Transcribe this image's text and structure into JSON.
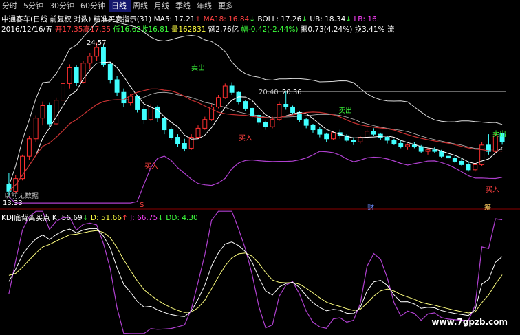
{
  "tabs": [
    {
      "label": "分时",
      "active": false
    },
    {
      "label": "5分钟",
      "active": false
    },
    {
      "label": "30分钟",
      "active": false
    },
    {
      "label": "60分钟",
      "active": false
    },
    {
      "label": "日线",
      "active": true
    },
    {
      "label": "周线",
      "active": false
    },
    {
      "label": "月线",
      "active": false
    },
    {
      "label": "季线",
      "active": false
    },
    {
      "label": "年线",
      "active": false
    },
    {
      "label": "更多",
      "active": false
    }
  ],
  "header": {
    "name": "中通客车(日线 前复权 对数)",
    "indicator": "精准买卖指示(31)",
    "ma5": "MA5: 17.21",
    "ma5_arrow": "↑",
    "ma18": "MA18: 16.84",
    "ma18_arrow": "↓",
    "boll": "BOLL: 17.26",
    "boll_arrow": "↓",
    "ub": "UB: 18.34",
    "ub_arrow": "↓",
    "lb": "LB: 16."
  },
  "quote": {
    "date": "2016/12/16/五",
    "open": "开17.35",
    "high": "高17.35",
    "low": "低16.62",
    "close": "收16.81",
    "vol": "量162831",
    "amount": "额2.76亿",
    "change": "幅-0.42(-2.44%)",
    "amp": "振0.73(4.24%)",
    "turn": "换3.41%",
    "flow": "流"
  },
  "annotations": {
    "high_price": "24.57",
    "mid_price_left": "20.40",
    "mid_price_right": "20.36",
    "sell": "卖出",
    "buy": "买入",
    "low_price": "13.33",
    "no_data": "以前无数据",
    "marker_s": "S",
    "marker_cai": "财",
    "marker_chou": "筹"
  },
  "kdj": {
    "title": "KDJ底背离买点",
    "k": "K: 56.69",
    "k_arrow": "↓",
    "d": "D: 51.66",
    "d_arrow": "↑",
    "j": "J: 66.75",
    "j_arrow": "↓",
    "dd": "DD: 4.30"
  },
  "watermark": "www.7gpzb.com",
  "colors": {
    "up": "#ff3030",
    "down": "#40ffff",
    "ma5": "#ffffff",
    "ma18": "#c83030",
    "boll_mid": "#bbbbbb",
    "purple": "#b040d0",
    "k": "#ffffff",
    "d": "#ffff80",
    "j": "#b040d0"
  },
  "chart_data": {
    "type": "candlestick",
    "price_axis": "log",
    "candles": [
      [
        14.3,
        14.9,
        13.6,
        13.9
      ],
      [
        13.9,
        14.8,
        13.8,
        14.6
      ],
      [
        14.6,
        16.0,
        14.5,
        15.9
      ],
      [
        15.9,
        17.2,
        15.7,
        17.0
      ],
      [
        17.0,
        18.6,
        16.8,
        18.4
      ],
      [
        18.4,
        19.6,
        17.9,
        19.3
      ],
      [
        19.3,
        19.5,
        17.8,
        18.0
      ],
      [
        18.0,
        19.9,
        17.9,
        19.7
      ],
      [
        19.7,
        21.2,
        19.5,
        21.0
      ],
      [
        21.0,
        22.6,
        20.6,
        22.3
      ],
      [
        22.3,
        22.5,
        20.8,
        21.1
      ],
      [
        21.1,
        22.9,
        21.0,
        22.7
      ],
      [
        22.7,
        23.6,
        22.2,
        23.3
      ],
      [
        23.3,
        24.57,
        22.9,
        24.1
      ],
      [
        24.1,
        24.3,
        22.4,
        22.6
      ],
      [
        22.6,
        22.8,
        21.0,
        21.3
      ],
      [
        21.3,
        21.6,
        20.0,
        20.3
      ],
      [
        20.3,
        20.6,
        19.2,
        19.5
      ],
      [
        19.5,
        20.2,
        19.3,
        20.0
      ],
      [
        20.0,
        20.1,
        18.8,
        19.0
      ],
      [
        19.0,
        19.3,
        18.0,
        18.3
      ],
      [
        18.3,
        19.4,
        18.2,
        19.2
      ],
      [
        19.2,
        19.3,
        18.1,
        18.4
      ],
      [
        18.4,
        18.5,
        17.3,
        17.6
      ],
      [
        17.6,
        17.8,
        16.9,
        17.1
      ],
      [
        17.1,
        17.3,
        16.5,
        16.7
      ],
      [
        16.7,
        17.0,
        16.2,
        16.4
      ],
      [
        16.4,
        17.3,
        16.3,
        17.1
      ],
      [
        17.1,
        17.9,
        17.0,
        17.7
      ],
      [
        17.7,
        18.5,
        17.6,
        18.3
      ],
      [
        18.3,
        19.4,
        18.2,
        19.2
      ],
      [
        19.2,
        20.1,
        19.1,
        19.9
      ],
      [
        19.9,
        21.0,
        19.8,
        20.8
      ],
      [
        20.8,
        21.1,
        20.1,
        20.3
      ],
      [
        20.3,
        20.4,
        19.4,
        19.6
      ],
      [
        19.6,
        19.7,
        18.9,
        19.1
      ],
      [
        19.1,
        19.2,
        18.4,
        18.6
      ],
      [
        18.6,
        18.7,
        17.9,
        18.1
      ],
      [
        18.1,
        18.2,
        17.6,
        17.8
      ],
      [
        17.8,
        18.5,
        17.7,
        18.3
      ],
      [
        18.3,
        19.6,
        18.2,
        19.4
      ],
      [
        19.4,
        20.4,
        19.0,
        19.2
      ],
      [
        19.2,
        19.3,
        18.6,
        18.8
      ],
      [
        18.8,
        18.9,
        18.1,
        18.3
      ],
      [
        18.3,
        18.4,
        17.7,
        17.9
      ],
      [
        17.9,
        18.0,
        17.4,
        17.6
      ],
      [
        17.6,
        17.8,
        17.1,
        17.3
      ],
      [
        17.3,
        17.4,
        16.8,
        17.0
      ],
      [
        17.0,
        17.5,
        16.9,
        17.4
      ],
      [
        17.4,
        17.6,
        17.0,
        17.2
      ],
      [
        17.2,
        17.3,
        16.8,
        16.9
      ],
      [
        16.9,
        17.1,
        16.6,
        16.8
      ],
      [
        16.8,
        17.2,
        16.7,
        17.1
      ],
      [
        17.1,
        17.6,
        17.0,
        17.5
      ],
      [
        17.5,
        17.7,
        17.2,
        17.3
      ],
      [
        17.3,
        17.4,
        16.9,
        17.1
      ],
      [
        17.1,
        17.2,
        16.7,
        16.9
      ],
      [
        16.9,
        17.0,
        16.6,
        16.7
      ],
      [
        16.7,
        16.9,
        16.4,
        16.5
      ],
      [
        16.5,
        16.7,
        16.3,
        16.6
      ],
      [
        16.6,
        16.8,
        16.4,
        16.5
      ],
      [
        16.5,
        16.6,
        16.1,
        16.2
      ],
      [
        16.2,
        16.4,
        16.0,
        16.3
      ],
      [
        16.3,
        16.5,
        16.1,
        16.2
      ],
      [
        16.2,
        16.3,
        15.8,
        15.9
      ],
      [
        15.9,
        16.1,
        15.7,
        15.8
      ],
      [
        15.8,
        16.0,
        15.5,
        15.6
      ],
      [
        15.6,
        15.8,
        15.3,
        15.4
      ],
      [
        15.4,
        15.6,
        15.0,
        15.1
      ],
      [
        15.1,
        15.5,
        15.0,
        15.4
      ],
      [
        15.4,
        16.8,
        15.3,
        16.6
      ],
      [
        16.6,
        17.3,
        16.0,
        16.2
      ],
      [
        16.2,
        17.35,
        16.1,
        17.2
      ],
      [
        17.35,
        17.35,
        16.62,
        16.81
      ]
    ]
  }
}
